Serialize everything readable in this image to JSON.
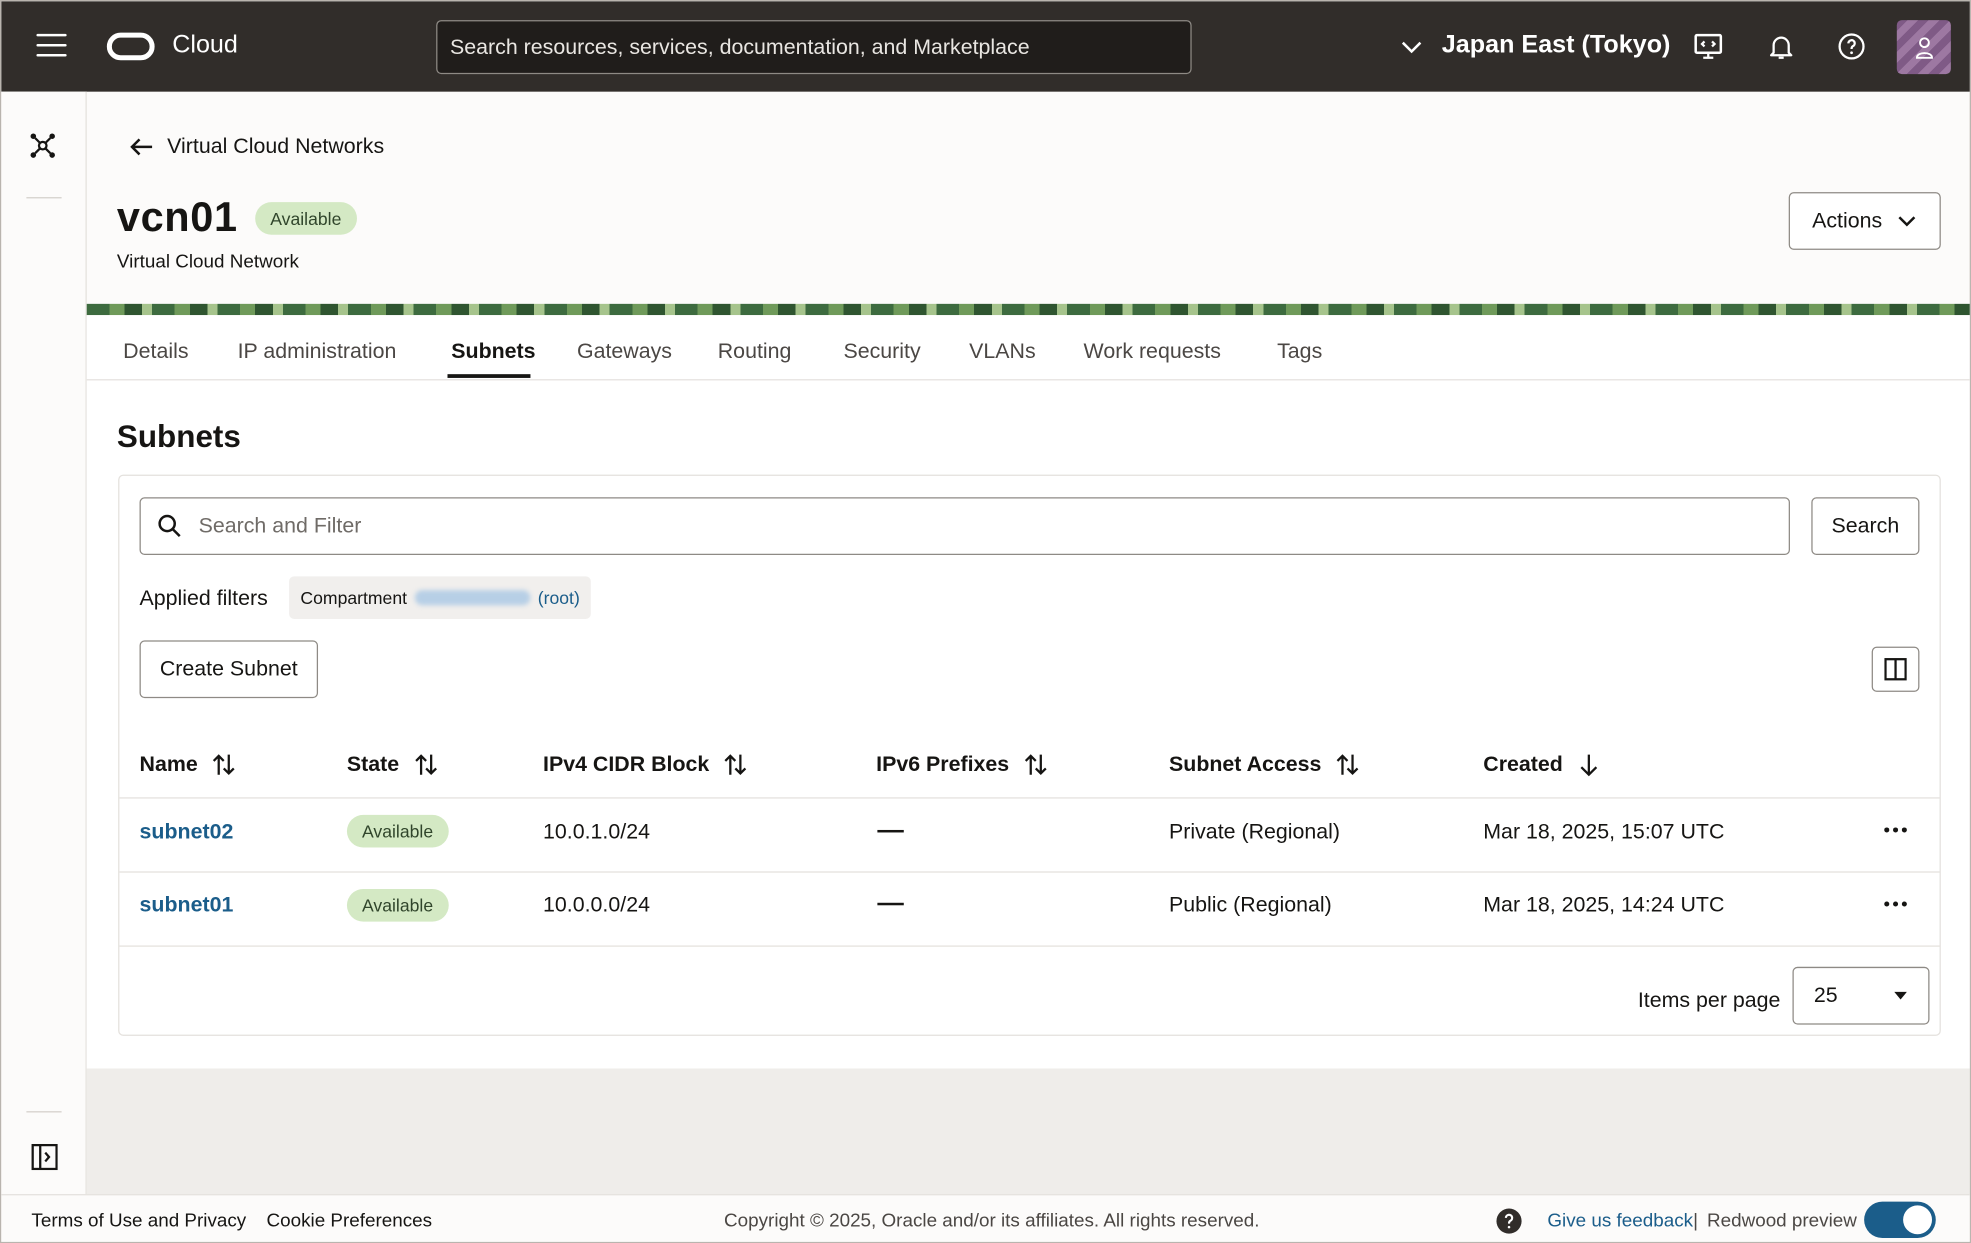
{
  "header": {
    "brand": "Cloud",
    "search_placeholder": "Search resources, services, documentation, and Marketplace",
    "region": "Japan East (Tokyo)",
    "icons": [
      "hamburger-menu-icon",
      "oracle-logo-icon",
      "chevron-down-icon",
      "developer-tools-icon",
      "bell-icon",
      "help-icon",
      "profile-icon"
    ]
  },
  "rail": {
    "icons": [
      "network-icon",
      "expand-panel-icon"
    ]
  },
  "breadcrumb": {
    "back_label": "Virtual Cloud Networks"
  },
  "page": {
    "title": "vcn01",
    "status": "Available",
    "subtitle": "Virtual Cloud Network",
    "actions_label": "Actions"
  },
  "tabs": [
    {
      "label": "Details"
    },
    {
      "label": "IP administration"
    },
    {
      "label": "Subnets",
      "active": true
    },
    {
      "label": "Gateways"
    },
    {
      "label": "Routing"
    },
    {
      "label": "Security"
    },
    {
      "label": "VLANs"
    },
    {
      "label": "Work requests"
    },
    {
      "label": "Tags"
    }
  ],
  "subnets": {
    "section_title": "Subnets",
    "filter_placeholder": "Search and Filter",
    "search_label": "Search",
    "applied_filters_label": "Applied filters",
    "compartment_chip": {
      "label": "Compartment",
      "root": "(root)"
    },
    "create_label": "Create Subnet",
    "columns": [
      "Name",
      "State",
      "IPv4 CIDR Block",
      "IPv6 Prefixes",
      "Subnet Access",
      "Created"
    ],
    "rows": [
      {
        "name": "subnet02",
        "state": "Available",
        "cidr": "10.0.1.0/24",
        "ipv6": "",
        "access": "Private (Regional)",
        "created": "Mar 18, 2025, 15:07 UTC"
      },
      {
        "name": "subnet01",
        "state": "Available",
        "cidr": "10.0.0.0/24",
        "ipv6": "",
        "access": "Public (Regional)",
        "created": "Mar 18, 2025, 14:24 UTC"
      }
    ],
    "items_per_page_label": "Items per page",
    "items_per_page": "25"
  },
  "footer": {
    "terms": "Terms of Use and Privacy",
    "cookies": "Cookie Preferences",
    "copyright": "Copyright © 2025, Oracle and/or its affiliates. All rights reserved.",
    "feedback": "Give us feedback",
    "separator": "|",
    "redwood": "Redwood preview",
    "redwood_enabled": true
  },
  "colors": {
    "header_bg": "#312d2a",
    "link": "#1b5d8a",
    "badge_bg": "#d4e9c4"
  }
}
